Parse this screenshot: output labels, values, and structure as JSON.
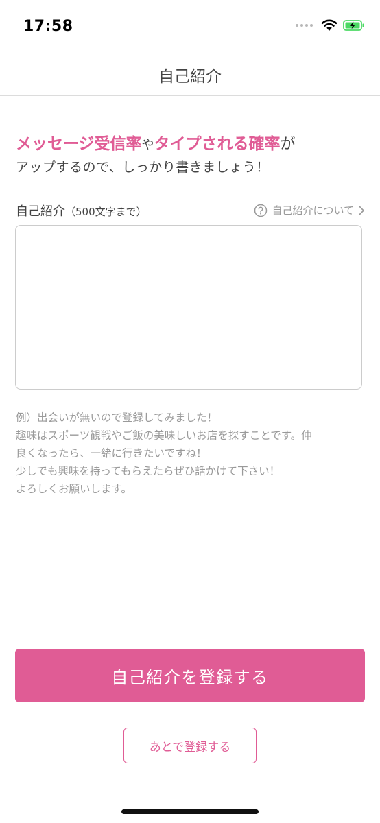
{
  "status_bar": {
    "time": "17:58",
    "icons": [
      "signal-dots-icon",
      "wifi-icon",
      "battery-charging-icon"
    ]
  },
  "nav": {
    "title": "自己紹介"
  },
  "headline": {
    "part1": "メッセージ受信率",
    "part2": "や",
    "part3": "タイプされる確率",
    "part4": "が",
    "line2": "アップするので、しっかり書きましょう！"
  },
  "field": {
    "label": "自己紹介",
    "limit": "（500文字まで）",
    "about_link": "自己紹介について",
    "value": "",
    "placeholder": ""
  },
  "example": {
    "lines": [
      "例）出会いが無いので登録してみました！",
      "趣味はスポーツ観戦やご飯の美味しいお店を探すことです。仲",
      "良くなったら、一緒に行きたいですね！",
      "少しでも興味を持ってもらえたらぜひ話かけて下さい！",
      "よろしくお願いします。"
    ]
  },
  "buttons": {
    "register": "自己紹介を登録する",
    "later": "あとで登録する"
  },
  "colors": {
    "accent": "#e05c95",
    "text": "#444444",
    "muted": "#9a9a9a",
    "battery_green": "#4cd964"
  }
}
